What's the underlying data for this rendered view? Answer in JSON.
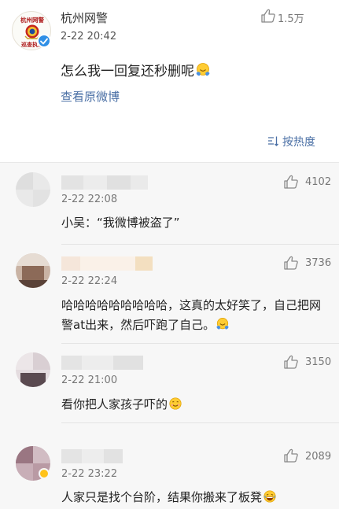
{
  "colors": {
    "link": "#4a6fa5",
    "verified": "#2f8fe6",
    "comment_bg": "#f7f7f7"
  },
  "post": {
    "author": "杭州网警",
    "avatar_caption": "杭州网警 巡查执法",
    "verified_icon": "verified-check-icon",
    "time": "2-22 20:42",
    "like_count": "1.5万",
    "text": "怎么我一回复还秒删呢",
    "text_emoji": "shy-emoji-icon",
    "view_original": "查看原微博",
    "sort_label": "按热度"
  },
  "comments": [
    {
      "time": "2-22 22:08",
      "likes": "4102",
      "text": "小吴：“我微博被盗了”"
    },
    {
      "time": "2-22 22:24",
      "likes": "3736",
      "text": "哈哈哈哈哈哈哈哈哈，这真的太好笑了，自己把网警at出来，然后吓跑了自己。",
      "emoji": "shy-emoji-icon"
    },
    {
      "time": "2-22 21:00",
      "likes": "3150",
      "text": "看你把人家孩子吓的",
      "emoji": "smile-emoji-icon"
    },
    {
      "time": "2-22 23:22",
      "likes": "2089",
      "text": "人家只是找个台阶，结果你搬来了板凳",
      "emoji": "laugh-emoji-icon"
    }
  ]
}
